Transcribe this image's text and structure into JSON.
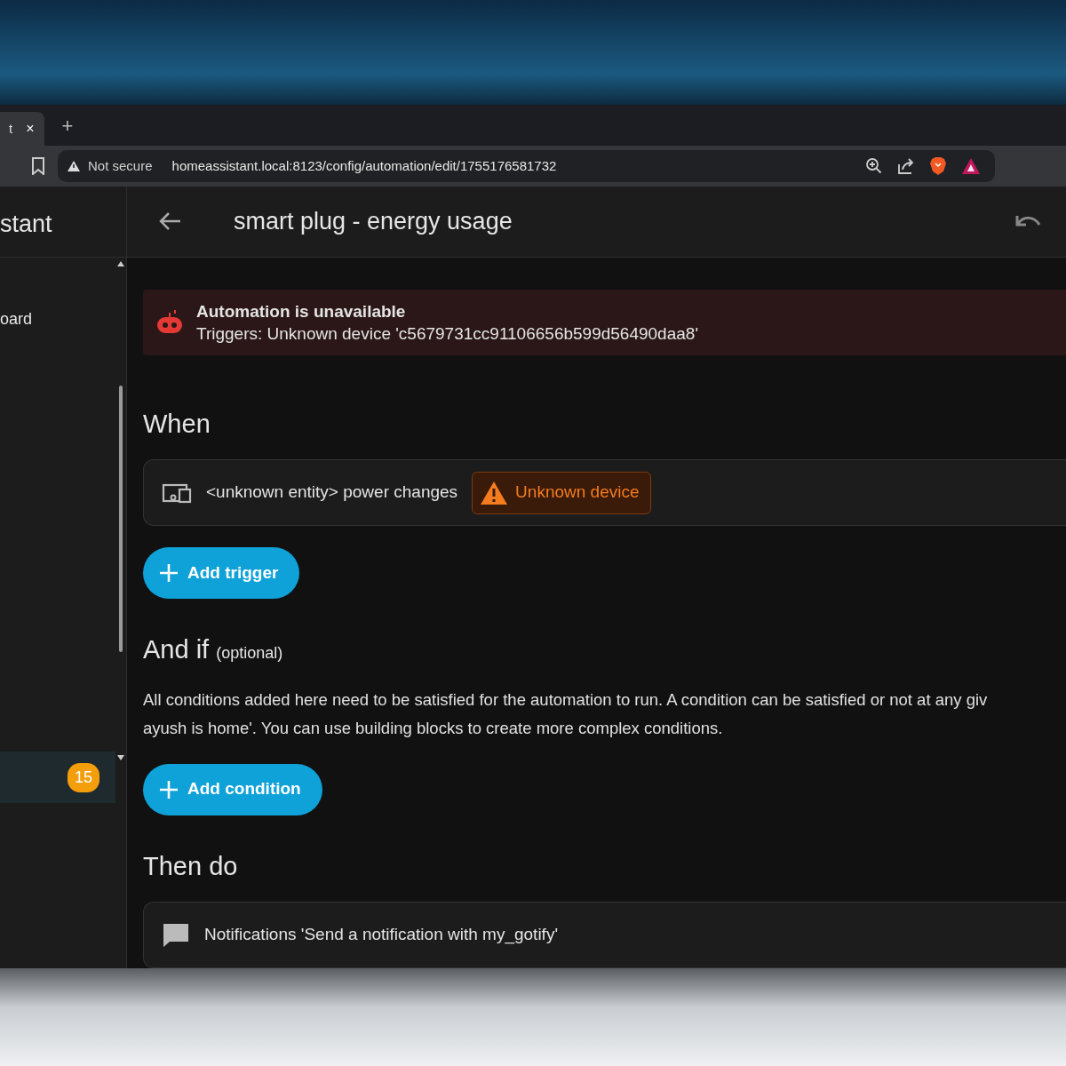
{
  "browser": {
    "tabs": [
      {
        "label": "t",
        "close": "×",
        "selected": true
      }
    ],
    "new_tab": "+",
    "security": "Not secure",
    "url": "homeassistant.local:8123/config/automation/edit/1755176581732"
  },
  "sidebar": {
    "title": "stant",
    "items": [
      {
        "label": "oard",
        "selected": false
      },
      {
        "badge": "15",
        "selected": true
      }
    ]
  },
  "header": {
    "title": "smart plug - energy usage"
  },
  "alert": {
    "title": "Automation is unavailable",
    "message": "Triggers: Unknown device 'c5679731cc91106656b599d56490daa8'"
  },
  "sections": [
    {
      "title": "When",
      "rows": [
        {
          "kind": "trigger",
          "text": "<unknown entity> power changes",
          "warning": "Unknown device"
        }
      ],
      "button": "Add trigger"
    },
    {
      "title": "And if",
      "note": "(optional)",
      "description": [
        "All conditions added here need to be satisfied for the automation to run. A condition can be satisfied or not at any giv",
        "ayush is home'. You can use building blocks to create more complex conditions."
      ],
      "button": "Add condition"
    },
    {
      "title": "Then do",
      "rows": [
        {
          "kind": "action",
          "text": "Notifications 'Send a notification with my_gotify'"
        }
      ]
    }
  ]
}
